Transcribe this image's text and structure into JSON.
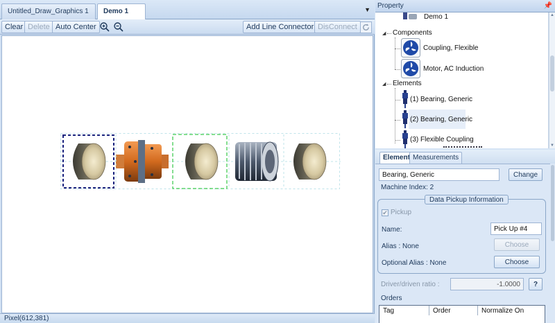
{
  "document_tabs": [
    {
      "label": "Untitled_Draw_Graphics 1",
      "active": false
    },
    {
      "label": "Demo 1",
      "active": true
    }
  ],
  "toolbar": {
    "clear_label": "Clear",
    "delete_label": "Delete",
    "auto_center_label": "Auto Center",
    "zoom_in_icon": "zoom-in-icon",
    "zoom_out_icon": "zoom-out-icon",
    "add_line_connector_label": "Add Line Connector",
    "disconnect_label": "DisConnect",
    "refresh_icon": "refresh-icon"
  },
  "canvas": {
    "train": [
      {
        "type": "bearing",
        "selected": true
      },
      {
        "type": "coupling"
      },
      {
        "type": "bearing",
        "hover": true
      },
      {
        "type": "motor"
      },
      {
        "type": "bearing"
      }
    ]
  },
  "status_bar": {
    "text": "Pixel(612,381)"
  },
  "property_panel": {
    "title": "Property",
    "tree": {
      "root_label": "Demo 1",
      "components_label": "Components",
      "components": [
        {
          "label": "Coupling, Flexible",
          "icon": "fan-icon"
        },
        {
          "label": "Motor, AC Induction",
          "icon": "fan-icon"
        }
      ],
      "elements_label": "Elements",
      "elements": [
        {
          "label": "(1) Bearing, Generic",
          "icon": "sensor-icon"
        },
        {
          "label": "(2) Bearing, Generic",
          "icon": "sensor-icon",
          "selected": true
        },
        {
          "label": "(3) Flexible Coupling",
          "icon": "sensor-icon"
        }
      ]
    },
    "tabs": [
      {
        "label": "Element",
        "active": true
      },
      {
        "label": "Measurements",
        "active": false
      }
    ],
    "element": {
      "name_value": "Bearing, Generic",
      "change_label": "Change",
      "machine_index": "Machine Index: 2",
      "group_title": "Data Pickup Information",
      "pickup_label": "Pickup",
      "pickup_checked": true,
      "name_label": "Name:",
      "name_field_value": "Pick Up #4",
      "alias_label": "Alias : None",
      "choose_disabled_label": "Choose",
      "optional_alias_label": "Optional Alias : None",
      "choose_label": "Choose",
      "ratio_label": "Driver/driven ratio :",
      "ratio_value": "-1.0000",
      "help_label": "?",
      "orders_label": "Orders",
      "orders_columns": [
        "Tag",
        "Order",
        "Normalize On"
      ]
    }
  },
  "colors": {
    "accent": "#1e395b",
    "panel_bg": "#d5e4f5",
    "selection_dash": "#1a237e",
    "hover_dash": "#5dd36b"
  }
}
